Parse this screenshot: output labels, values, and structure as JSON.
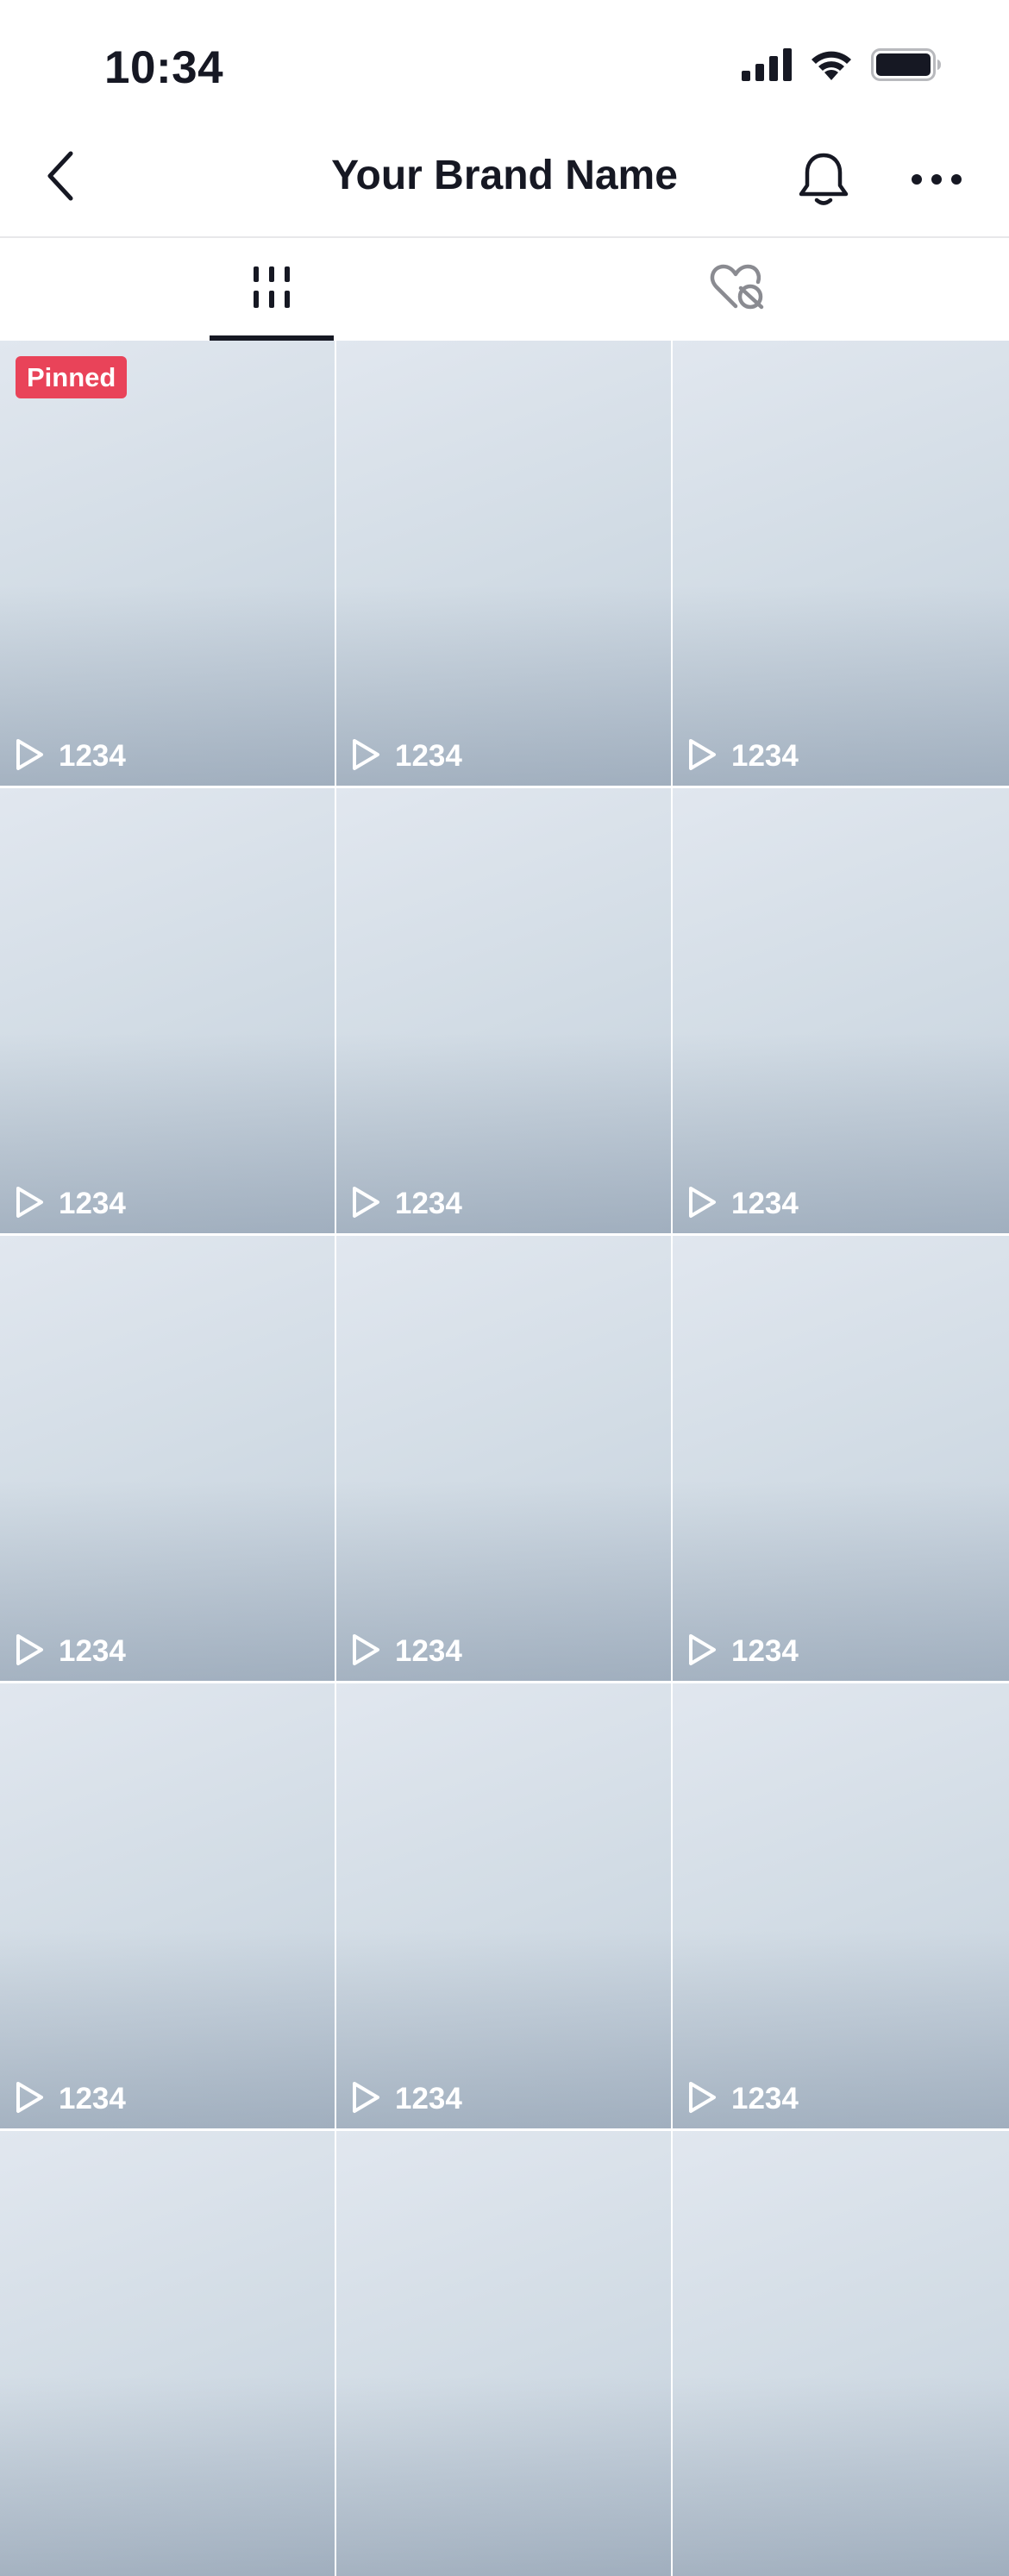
{
  "status_bar": {
    "time": "10:34",
    "icons": [
      "cellular-signal-icon",
      "wifi-icon",
      "battery-icon"
    ]
  },
  "header": {
    "title": "Your Brand Name",
    "back_icon": "chevron-left-icon",
    "notification_icon": "bell-icon",
    "more_icon": "more-horizontal-icon"
  },
  "tabs": [
    {
      "name": "videos",
      "icon": "grid-icon",
      "active": true
    },
    {
      "name": "liked",
      "icon": "heart-hidden-icon",
      "active": false
    }
  ],
  "colors": {
    "text": "#161823",
    "pinned_badge": "#e94359",
    "tab_indicator": "#161823",
    "divider": "#e8e8ea"
  },
  "grid": {
    "pinned_label": "Pinned",
    "play_icon": "play-outline-icon",
    "videos": [
      {
        "views": "1234",
        "pinned": true
      },
      {
        "views": "1234",
        "pinned": false
      },
      {
        "views": "1234",
        "pinned": false
      },
      {
        "views": "1234",
        "pinned": false
      },
      {
        "views": "1234",
        "pinned": false
      },
      {
        "views": "1234",
        "pinned": false
      },
      {
        "views": "1234",
        "pinned": false
      },
      {
        "views": "1234",
        "pinned": false
      },
      {
        "views": "1234",
        "pinned": false
      },
      {
        "views": "1234",
        "pinned": false
      },
      {
        "views": "1234",
        "pinned": false
      },
      {
        "views": "1234",
        "pinned": false
      },
      {
        "views": null,
        "pinned": false
      },
      {
        "views": null,
        "pinned": false
      },
      {
        "views": null,
        "pinned": false
      }
    ]
  }
}
